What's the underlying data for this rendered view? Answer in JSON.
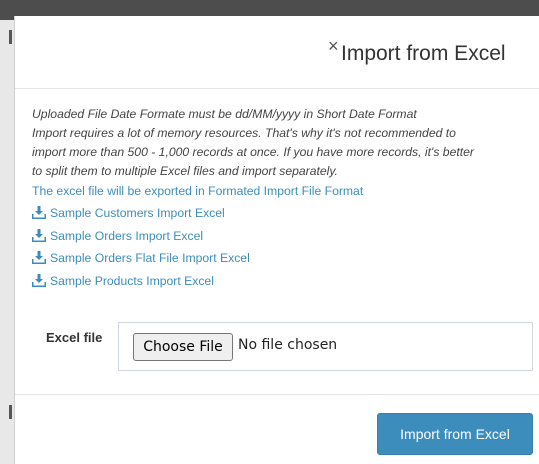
{
  "dialog": {
    "title": "Import from Excel",
    "close_glyph": "×"
  },
  "info": {
    "date_note": "Uploaded File Date Formate must be dd/MM/yyyy in Short Date Format",
    "memory_note_1": "Import requires a lot of memory resources. That's why it's not recommended to",
    "memory_note_2": "import more than 500 - 1,000 records at once. If you have more records, it's better",
    "memory_note_3": "to split them to multiple Excel files and import separately.",
    "export_note": "The excel file will be exported in Formated Import File Format"
  },
  "samples": [
    {
      "label": "Sample Customers Import Excel",
      "icon": "download-icon"
    },
    {
      "label": "Sample Orders Import Excel",
      "icon": "download-icon"
    },
    {
      "label": "Sample Orders Flat File Import Excel",
      "icon": "download-icon"
    },
    {
      "label": "Sample Products Import Excel",
      "icon": "download-icon"
    }
  ],
  "form": {
    "excel_file_label": "Excel file",
    "choose_file_label": "Choose File",
    "file_status": "No file chosen"
  },
  "footer": {
    "submit_label": "Import from Excel"
  },
  "colors": {
    "accent": "#3c8dbc",
    "title_text": "#333333"
  }
}
